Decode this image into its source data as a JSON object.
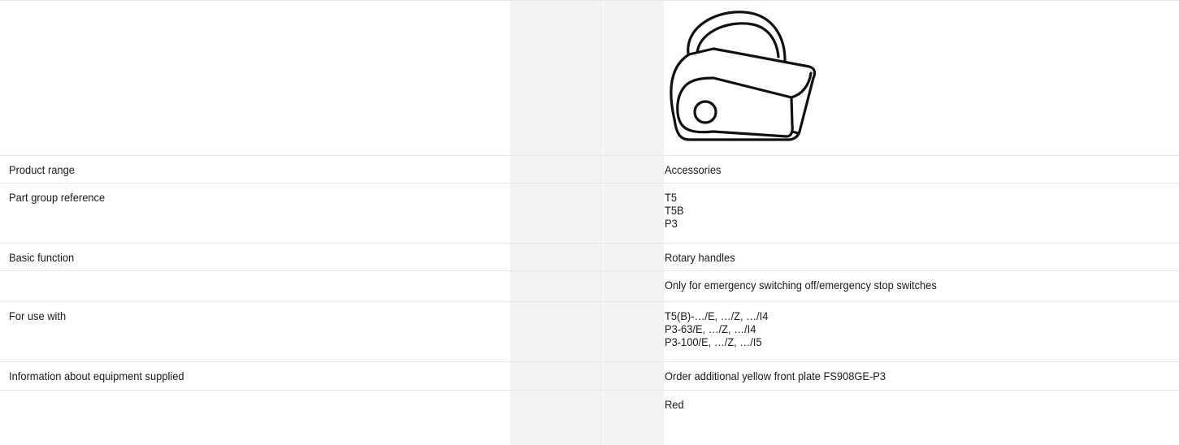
{
  "image": {
    "icon": "rotary-handle-product-icon"
  },
  "rows": [
    {
      "label": "Product range",
      "value": [
        "Accessories"
      ]
    },
    {
      "label": "Part group reference",
      "value": [
        "T5",
        "T5B",
        "P3"
      ]
    },
    {
      "label": "Basic function",
      "value": [
        "Rotary handles"
      ]
    },
    {
      "label": "",
      "value": [
        "Only for emergency switching off/emergency stop switches"
      ]
    },
    {
      "label": "For use with",
      "value": [
        "T5(B)-…/E, …/Z, …/I4",
        "P3-63/E, …/Z, …/I4",
        "P3-100/E, …/Z, …/I5"
      ]
    },
    {
      "label": "Information about equipment supplied",
      "value": [
        "Order additional yellow front plate FS908GE-P3"
      ]
    },
    {
      "label": "",
      "value": [
        "Red"
      ]
    }
  ]
}
